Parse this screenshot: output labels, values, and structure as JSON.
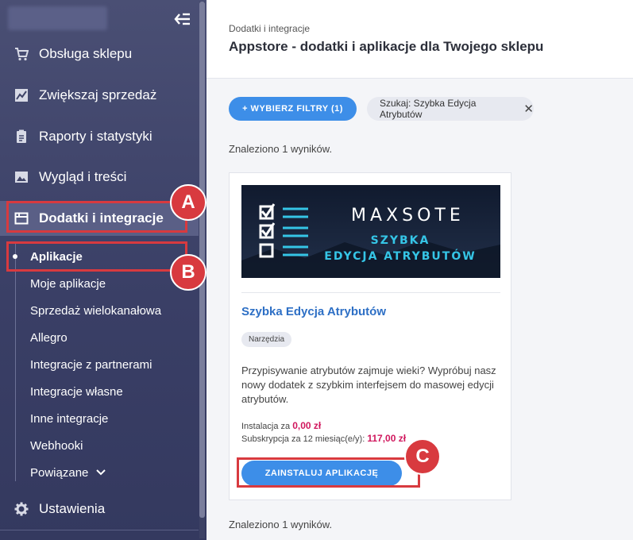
{
  "sidebar": {
    "items": [
      {
        "label": "Obsługa sklepu",
        "icon": "cart-icon"
      },
      {
        "label": "Zwiększaj sprzedaż",
        "icon": "chart-line-icon"
      },
      {
        "label": "Raporty i statystyki",
        "icon": "clipboard-icon"
      },
      {
        "label": "Wygląd i treści",
        "icon": "image-icon"
      },
      {
        "label": "Dodatki i integracje",
        "icon": "window-icon",
        "active": true
      },
      {
        "label": "Ustawienia",
        "icon": "gear-icon"
      }
    ],
    "subitems": [
      {
        "label": "Aplikacje",
        "active": true
      },
      {
        "label": "Moje aplikacje"
      },
      {
        "label": "Sprzedaż wielokanałowa"
      },
      {
        "label": "Allegro"
      },
      {
        "label": "Integracje z partnerami"
      },
      {
        "label": "Integracje własne"
      },
      {
        "label": "Inne integracje"
      },
      {
        "label": "Webhooki"
      },
      {
        "label": "Powiązane",
        "icon": "chevron-down-icon"
      }
    ]
  },
  "header": {
    "breadcrumb": "Dodatki i integracje",
    "title": "Appstore - dodatki i aplikacje dla Twojego sklepu"
  },
  "filters": {
    "button_label": "+ WYBIERZ FILTRY (1)",
    "chip_label": "Szukaj: Szybka Edycja Atrybutów"
  },
  "results": {
    "found_top": "Znaleziono 1 wyników.",
    "found_bottom": "Znaleziono 1 wyników."
  },
  "card": {
    "banner_brand": "MAXSOTE",
    "banner_line1": "SZYBKA",
    "banner_line2": "EDYCJA ATRYBUTÓW",
    "name": "Szybka Edycja Atrybutów",
    "tag": "Narzędzia",
    "description": "Przypisywanie atrybutów zajmuje wieki? Wypróbuj nasz nowy dodatek z szybkim interfejsem do masowej edycji atrybutów.",
    "install_label": "Instalacja za",
    "install_price": "0,00 zł",
    "subscription_label": "Subskrypcja za 12 miesiąc(e/y):",
    "subscription_price": "117,00 zł",
    "install_button": "ZAINSTALUJ APLIKACJĘ"
  },
  "annotations": {
    "a": "A",
    "b": "B",
    "c": "C",
    "color": "#d83a3f"
  }
}
